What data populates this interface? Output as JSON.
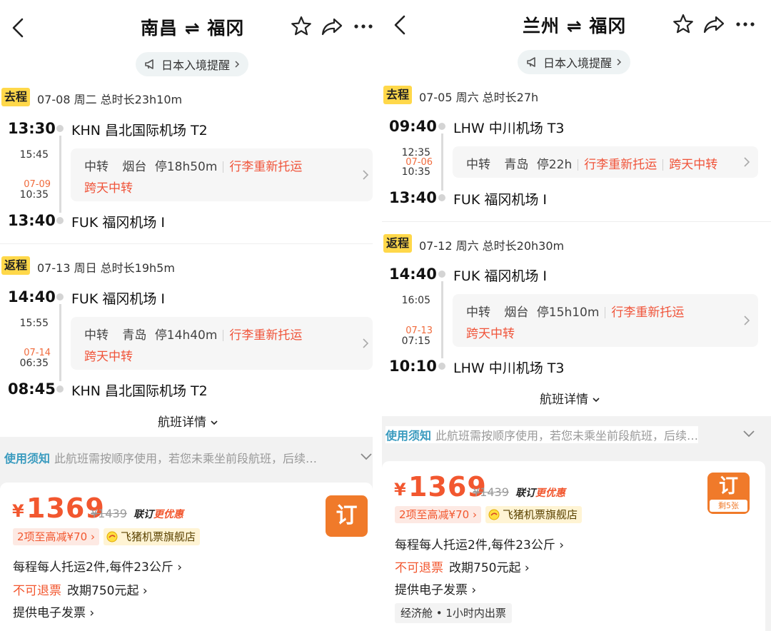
{
  "left": {
    "title": "南昌 ⇌ 福冈",
    "notice": "日本入境提醒",
    "outbound": {
      "tag": "去程",
      "info": "07-08  周二  总时长23h10m",
      "dep_time": "13:30",
      "dep_airport": "KHN 昌北国际机场 T2",
      "transfer_arr": "15:45",
      "transfer_dep_date": "07-09",
      "transfer_dep": "10:35",
      "transfer_label": "中转",
      "transfer_city": "烟台",
      "transfer_stay": "停18h50m",
      "transfer_note1": "行李重新托运",
      "transfer_note2": "跨天中转",
      "arr_time": "13:40",
      "arr_airport": "FUK 福冈机场 I"
    },
    "return": {
      "tag": "返程",
      "info": "07-13  周日  总时长19h5m",
      "dep_time": "14:40",
      "dep_airport": "FUK 福冈机场 I",
      "transfer_arr": "15:55",
      "transfer_dep_date": "07-14",
      "transfer_dep": "06:35",
      "transfer_label": "中转",
      "transfer_city": "青岛",
      "transfer_stay": "停14h40m",
      "transfer_note1": "行李重新托运",
      "transfer_note2": "跨天中转",
      "arr_time": "08:45",
      "arr_airport": "KHN 昌北国际机场 T2"
    },
    "flight_detail": "航班详情",
    "rules_key": "使用须知",
    "rules_text": "此航班需按顺序使用，若您未乘坐前段航班，后续…",
    "price_symbol": "¥",
    "price": "1369",
    "orig_price": "¥1439",
    "promo_a": "联订",
    "promo_b": "更优惠",
    "discount": "2项至高减¥70",
    "shop": "飞猪机票旗舰店",
    "baggage": "每程每人托运2件,每件23公斤",
    "refund": "不可退票",
    "change": "改期750元起",
    "invoice": "提供电子发票",
    "book": "订"
  },
  "right": {
    "title": "兰州 ⇌ 福冈",
    "notice": "日本入境提醒",
    "outbound": {
      "tag": "去程",
      "info": "07-05  周六  总时长27h",
      "dep_time": "09:40",
      "dep_airport": "LHW 中川机场 T3",
      "transfer_arr": "12:35",
      "transfer_dep_date": "07-06",
      "transfer_dep": "10:35",
      "transfer_label": "中转",
      "transfer_city": "青岛",
      "transfer_stay": "停22h",
      "transfer_note1": "行李重新托运",
      "transfer_note2": "跨天中转",
      "arr_time": "13:40",
      "arr_airport": "FUK 福冈机场 I"
    },
    "return": {
      "tag": "返程",
      "info": "07-12  周六  总时长20h30m",
      "dep_time": "14:40",
      "dep_airport": "FUK 福冈机场 I",
      "transfer_arr": "16:05",
      "transfer_dep_date": "07-13",
      "transfer_dep": "07:15",
      "transfer_label": "中转",
      "transfer_city": "烟台",
      "transfer_stay": "停15h10m",
      "transfer_note1": "行李重新托运",
      "transfer_note2": "跨天中转",
      "arr_time": "10:10",
      "arr_airport": "LHW 中川机场 T3"
    },
    "flight_detail": "航班详情",
    "rules_key": "使用须知",
    "rules_text": "此航班需按顺序使用，若您未乘坐前段航班，后续…",
    "price_symbol": "¥",
    "price": "1369",
    "orig_price": "¥1439",
    "promo_a": "联订",
    "promo_b": "更优惠",
    "discount": "2项至高减¥70",
    "shop": "飞猪机票旗舰店",
    "baggage": "每程每人托运2件,每件23公斤",
    "refund": "不可退票",
    "change": "改期750元起",
    "invoice": "提供电子发票",
    "cabin": "经济舱 • 1小时内出票",
    "book": "订",
    "remaining": "剩5张"
  },
  "colors": {
    "accent": "#f2572f",
    "tag": "#ffd84a",
    "link": "#3a9bbf",
    "book": "#f07a2a"
  },
  "icons": [
    "back-icon",
    "star-icon",
    "share-icon",
    "more-icon",
    "megaphone-icon",
    "chevron-right-icon",
    "chevron-down-icon",
    "fliggy-logo-icon"
  ]
}
